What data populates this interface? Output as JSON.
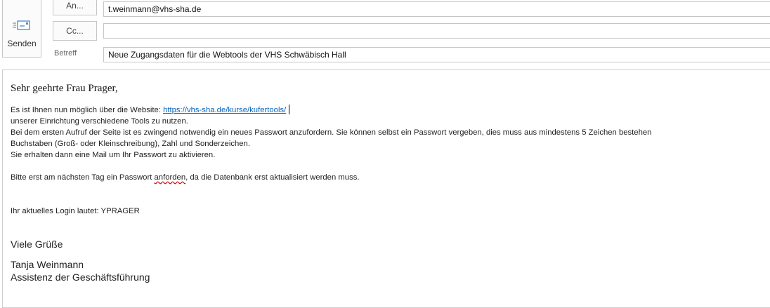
{
  "compose": {
    "send_label": "Senden",
    "to_button": "An...",
    "cc_button": "Cc...",
    "subject_label": "Betreff",
    "to_value": "t.weinmann@vhs-sha.de",
    "cc_value": "",
    "subject_value": "Neue Zugangsdaten für die Webtools der VHS Schwäbisch Hall"
  },
  "body": {
    "greeting": "Sehr geehrte Frau Prager,",
    "line1_prefix": "Es ist Ihnen nun möglich über die Website: ",
    "line1_link": "https://vhs-sha.de/kurse/kufertools/",
    "line2": "unserer Einrichtung verschiedene Tools zu nutzen.",
    "line3": "Bei dem ersten Aufruf der Seite ist es zwingend notwendig ein neues Passwort anzufordern. Sie können selbst ein Passwort vergeben, dies muss aus mindestens 5 Zeichen bestehen",
    "line4": "Buchstaben (Groß- oder Kleinschreibung), Zahl und Sonderzeichen.",
    "line5": "Sie erhalten dann eine Mail um Ihr Passwort zu aktivieren.",
    "line6_prefix": "Bitte erst am nächsten Tag ein Passwort ",
    "line6_misspelled": "anforden",
    "line6_suffix": ", da die Datenbank erst aktualisiert werden muss.",
    "login_line": "Ihr aktuelles Login lautet: YPRAGER",
    "closing": "Viele Grüße",
    "signature_name": "Tanja Weinmann",
    "signature_title": "Assistenz der Geschäftsführung"
  },
  "icons": {
    "send": "envelope-send-icon"
  }
}
